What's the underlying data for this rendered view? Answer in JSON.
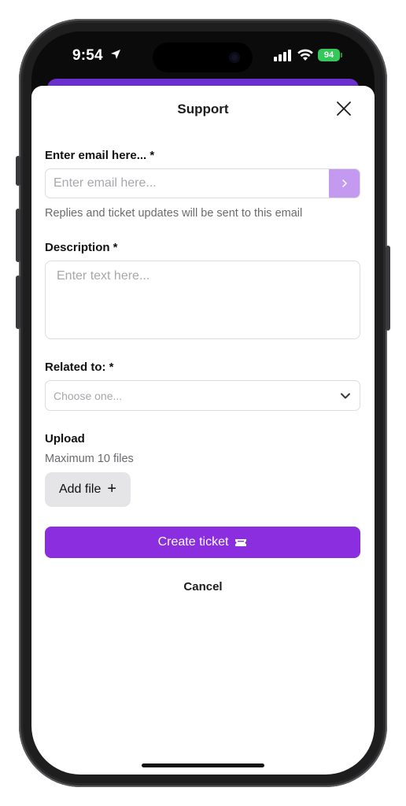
{
  "status_bar": {
    "time": "9:54",
    "battery": "94"
  },
  "sheet": {
    "title": "Support"
  },
  "email": {
    "label": "Enter email here... *",
    "placeholder": "Enter email here...",
    "submit_icon": "chevron-right-icon",
    "hint": "Replies and ticket updates will be sent to this email"
  },
  "description": {
    "label": "Description *",
    "placeholder": "Enter text here..."
  },
  "related": {
    "label": "Related to: *",
    "placeholder": "Choose one..."
  },
  "upload": {
    "label": "Upload",
    "hint": "Maximum 10 files",
    "add_label": "Add file"
  },
  "actions": {
    "create_label": "Create ticket",
    "cancel_label": "Cancel"
  },
  "colors": {
    "accent": "#8a2ee0",
    "accent_light": "#c39af0",
    "battery": "#34c759"
  }
}
